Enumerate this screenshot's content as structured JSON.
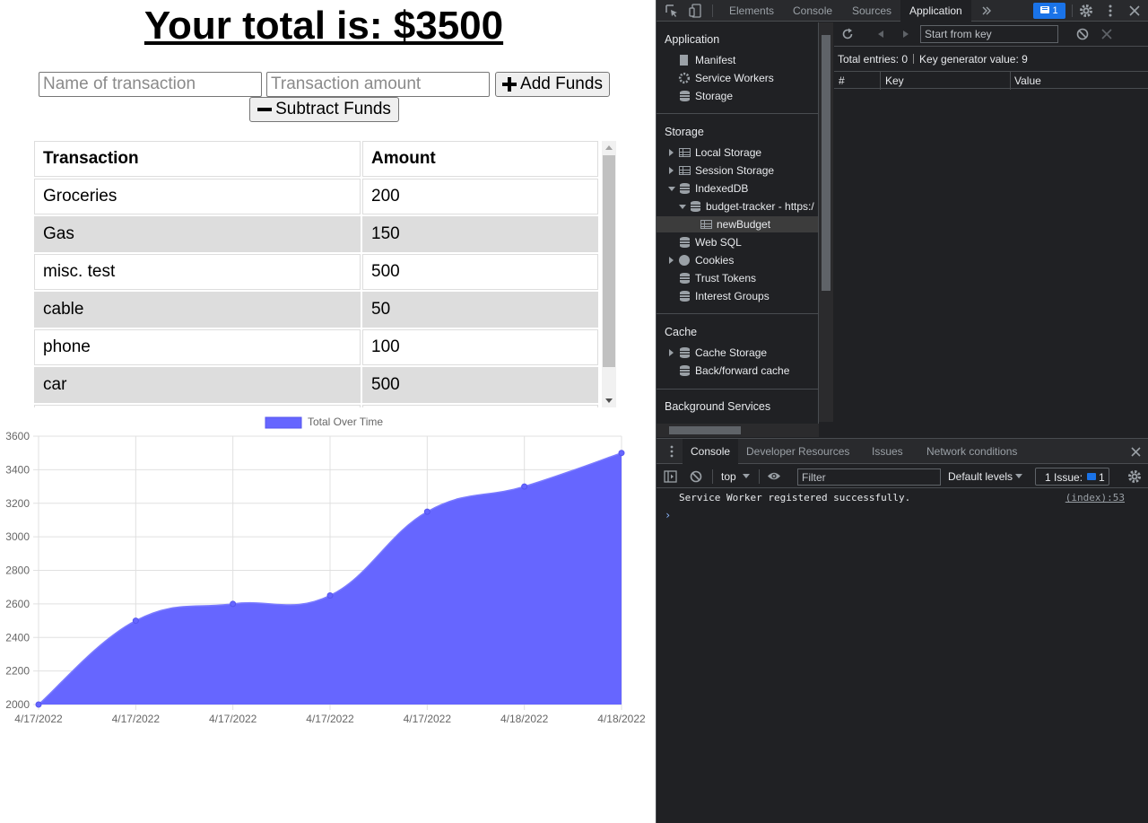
{
  "page": {
    "total_label": "Your total is: $3500",
    "name_placeholder": "Name of transaction",
    "amount_placeholder": "Transaction amount",
    "add_label": "Add Funds",
    "subtract_label": "Subtract Funds",
    "table": {
      "headers": [
        "Transaction",
        "Amount"
      ],
      "rows": [
        [
          "Groceries",
          "200"
        ],
        [
          "Gas",
          "150"
        ],
        [
          "misc. test",
          "500"
        ],
        [
          "cable",
          "50"
        ],
        [
          "phone",
          "100"
        ],
        [
          "car",
          "500"
        ]
      ]
    },
    "fill_color": "#6666ff"
  },
  "chart_data": {
    "type": "area",
    "x": [
      "4/17/2022",
      "4/17/2022",
      "4/17/2022",
      "4/17/2022",
      "4/17/2022",
      "4/18/2022",
      "4/18/2022"
    ],
    "series": [
      {
        "name": "Total Over Time",
        "values": [
          2000,
          2500,
          2600,
          2650,
          3150,
          3300,
          3500
        ],
        "color": "#6666ff"
      }
    ],
    "yticks": [
      3600,
      3400,
      3200,
      3000,
      2800,
      2600,
      2400,
      2200,
      2000
    ],
    "ylim": [
      2000,
      3600
    ],
    "grid": true,
    "legend": "top"
  },
  "devtools": {
    "tabs": [
      "Elements",
      "Console",
      "Sources",
      "Application"
    ],
    "active_tab": "Application",
    "issues_count": "1",
    "sidebar": {
      "application_title": "Application",
      "application_items": [
        "Manifest",
        "Service Workers",
        "Storage"
      ],
      "storage_title": "Storage",
      "storage_items": [
        "Local Storage",
        "Session Storage",
        "IndexedDB",
        "budget-tracker - https:/",
        "newBudget",
        "Web SQL",
        "Cookies",
        "Trust Tokens",
        "Interest Groups"
      ],
      "cache_title": "Cache",
      "cache_items": [
        "Cache Storage",
        "Back/forward cache"
      ],
      "bg_title": "Background Services"
    },
    "main": {
      "start_placeholder": "Start from key",
      "total_entries": "Total entries: 0",
      "key_gen": "Key generator value: 9",
      "columns": [
        "#",
        "Key",
        "Value"
      ]
    },
    "drawer": {
      "tabs": [
        "Console",
        "Developer Resources",
        "Issues",
        "Network conditions"
      ],
      "context": "top",
      "filter_placeholder": "Filter",
      "levels": "Default levels",
      "issues_label": "1 Issue:",
      "issues_count": "1",
      "log_message": "Service Worker registered successfully.",
      "log_source": "(index):53",
      "prompt_symbol": "›"
    }
  }
}
